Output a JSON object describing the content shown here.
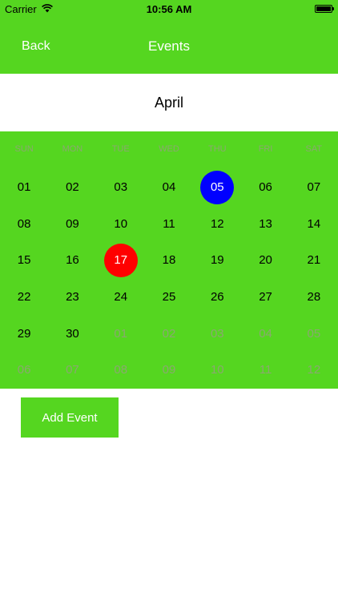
{
  "status_bar": {
    "carrier": "Carrier",
    "time": "10:56 AM",
    "wifi_icon": "wifi-icon",
    "battery_icon": "battery-icon"
  },
  "nav": {
    "back_label": "Back",
    "title": "Events"
  },
  "calendar": {
    "month": "April",
    "weekdays": [
      "SUN",
      "MON",
      "TUE",
      "WED",
      "THU",
      "FRI",
      "SAT"
    ],
    "days": [
      {
        "label": "01",
        "other": false
      },
      {
        "label": "02",
        "other": false
      },
      {
        "label": "03",
        "other": false
      },
      {
        "label": "04",
        "other": false
      },
      {
        "label": "05",
        "other": false,
        "state": "selected"
      },
      {
        "label": "06",
        "other": false
      },
      {
        "label": "07",
        "other": false
      },
      {
        "label": "08",
        "other": false
      },
      {
        "label": "09",
        "other": false
      },
      {
        "label": "10",
        "other": false
      },
      {
        "label": "11",
        "other": false
      },
      {
        "label": "12",
        "other": false
      },
      {
        "label": "13",
        "other": false
      },
      {
        "label": "14",
        "other": false
      },
      {
        "label": "15",
        "other": false
      },
      {
        "label": "16",
        "other": false
      },
      {
        "label": "17",
        "other": false,
        "state": "today"
      },
      {
        "label": "18",
        "other": false
      },
      {
        "label": "19",
        "other": false
      },
      {
        "label": "20",
        "other": false
      },
      {
        "label": "21",
        "other": false
      },
      {
        "label": "22",
        "other": false
      },
      {
        "label": "23",
        "other": false
      },
      {
        "label": "24",
        "other": false
      },
      {
        "label": "25",
        "other": false
      },
      {
        "label": "26",
        "other": false
      },
      {
        "label": "27",
        "other": false
      },
      {
        "label": "28",
        "other": false
      },
      {
        "label": "29",
        "other": false
      },
      {
        "label": "30",
        "other": false
      },
      {
        "label": "01",
        "other": true
      },
      {
        "label": "02",
        "other": true
      },
      {
        "label": "03",
        "other": true
      },
      {
        "label": "04",
        "other": true
      },
      {
        "label": "05",
        "other": true
      },
      {
        "label": "06",
        "other": true
      },
      {
        "label": "07",
        "other": true
      },
      {
        "label": "08",
        "other": true
      },
      {
        "label": "09",
        "other": true
      },
      {
        "label": "10",
        "other": true
      },
      {
        "label": "11",
        "other": true
      },
      {
        "label": "12",
        "other": true
      }
    ]
  },
  "actions": {
    "add_event_label": "Add Event"
  },
  "colors": {
    "accent": "#55d620",
    "selected": "#0000ff",
    "today": "#ff0000",
    "muted_text": "#8aa870"
  }
}
